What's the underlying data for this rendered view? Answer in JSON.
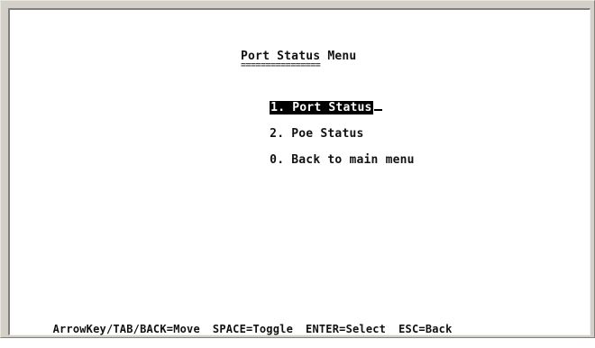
{
  "menu": {
    "title": "Port Status Menu",
    "title_underline": "================",
    "items": [
      {
        "label": "1. Port Status",
        "selected": true
      },
      {
        "label": "2. Poe Status",
        "selected": false
      },
      {
        "label": "0. Back to main menu",
        "selected": false
      }
    ]
  },
  "statusbar": {
    "hints": [
      "ArrowKey/TAB/BACK=Move",
      "SPACE=Toggle",
      "ENTER=Select",
      "ESC=Back"
    ]
  },
  "colors": {
    "background": "#ffffff",
    "text": "#111111",
    "highlight_bg": "#000000",
    "highlight_text": "#ffffff",
    "window_frame": "#d4d0c8"
  }
}
